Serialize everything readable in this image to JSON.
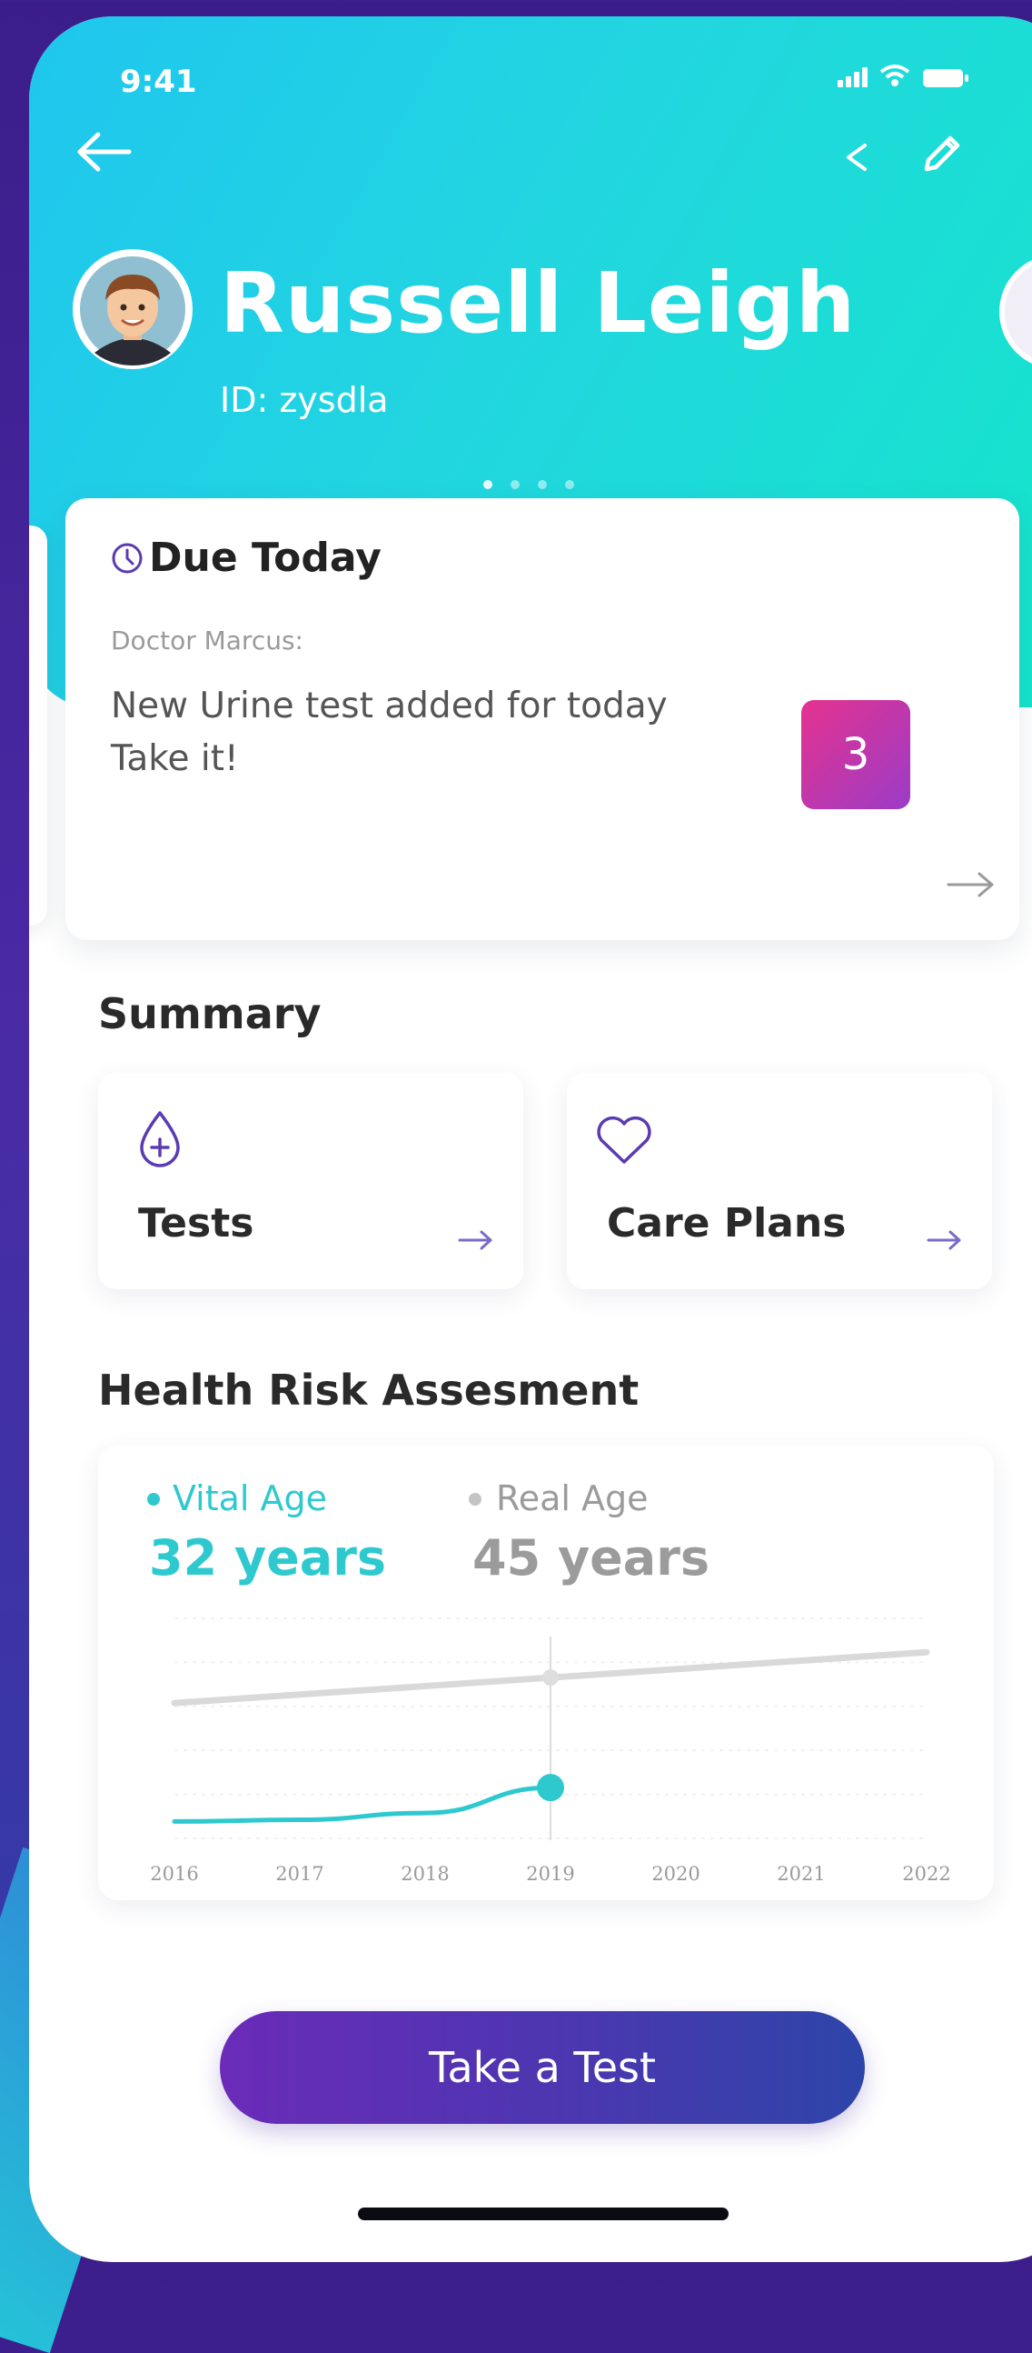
{
  "status_bar": {
    "time": "9:41"
  },
  "profile": {
    "name": "Russell Leigh",
    "id_label": "ID: zysdla"
  },
  "due_card": {
    "title": "Due Today",
    "from": "Doctor Marcus:",
    "message_line1": "New Urine test added for today",
    "message_line2": "Take it!",
    "badge_count": "3"
  },
  "summary": {
    "title": "Summary",
    "cards": [
      {
        "label": "Tests",
        "icon": "blood-drop-plus-icon"
      },
      {
        "label": "Care Plans",
        "icon": "heart-icon"
      }
    ]
  },
  "health_risk": {
    "title": "Health Risk Assesment",
    "vital_label": "Vital Age",
    "vital_value": "32 years",
    "real_label": "Real Age",
    "real_value": "45 years"
  },
  "chart_data": {
    "type": "line",
    "x": [
      "2016",
      "2017",
      "2018",
      "2019",
      "2020",
      "2021",
      "2022"
    ],
    "series": [
      {
        "name": "Real Age",
        "values": [
          42,
          43,
          44,
          45,
          46,
          47,
          48
        ]
      },
      {
        "name": "Vital Age",
        "values": [
          28,
          28.2,
          29,
          32,
          null,
          null,
          null
        ]
      }
    ],
    "highlight_x": "2019",
    "colors": {
      "vital": "#2ec9cf",
      "real": "#d9d9d9"
    }
  },
  "cta": {
    "label": "Take a Test"
  },
  "colors": {
    "header_start": "#1fc6ee",
    "header_end": "#14e5c9",
    "accent_purple": "#5b3bb0",
    "teal": "#2ec9cf",
    "badge_pink": "#e5328f"
  }
}
